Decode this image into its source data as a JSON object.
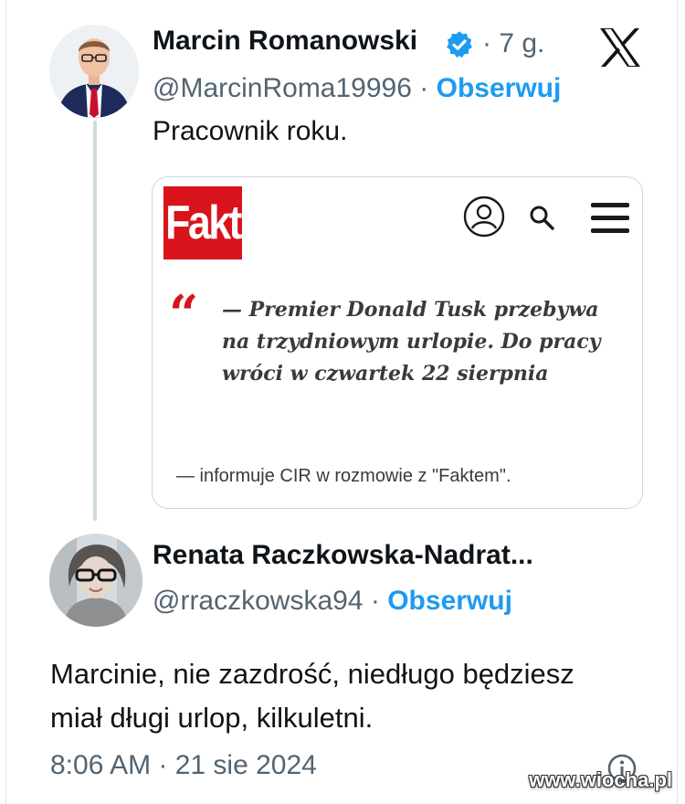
{
  "tweet": {
    "author_name": "Marcin Romanowski",
    "time_ago": "· 7 g.",
    "handle": "@MarcinRoma19996",
    "separator": "·",
    "follow_label": "Obserwuj",
    "text": "Pracownik roku.",
    "quoted_card": {
      "logo_text": "Fakt",
      "quote_mark": "“",
      "quote_text": "— Premier Donald Tusk przebywa na trzydniowym urlopie. Do pracy wróci w czwartek 22 sierpnia",
      "source_text": "— informuje CIR w rozmowie z \"Faktem\"."
    }
  },
  "reply": {
    "author_name": "Renata Raczkowska-Nadrat...",
    "handle": "@rraczkowska94",
    "separator": "·",
    "follow_label": "Obserwuj",
    "text_line1": "Marcinie, nie zazdrość, niedługo będziesz",
    "text_line2": "miał długi urlop, kilkuletni.",
    "timestamp": "8:06 AM · 21 sie 2024"
  },
  "watermark": "www.wiocha.pl",
  "colors": {
    "accent": "#1d9bf0",
    "fakt_red": "#d8131b",
    "text": "#0f1419",
    "secondary": "#536471"
  },
  "icons": [
    "verified-badge-icon",
    "x-logo-icon",
    "user-account-icon",
    "search-icon",
    "menu-icon",
    "info-icon"
  ]
}
